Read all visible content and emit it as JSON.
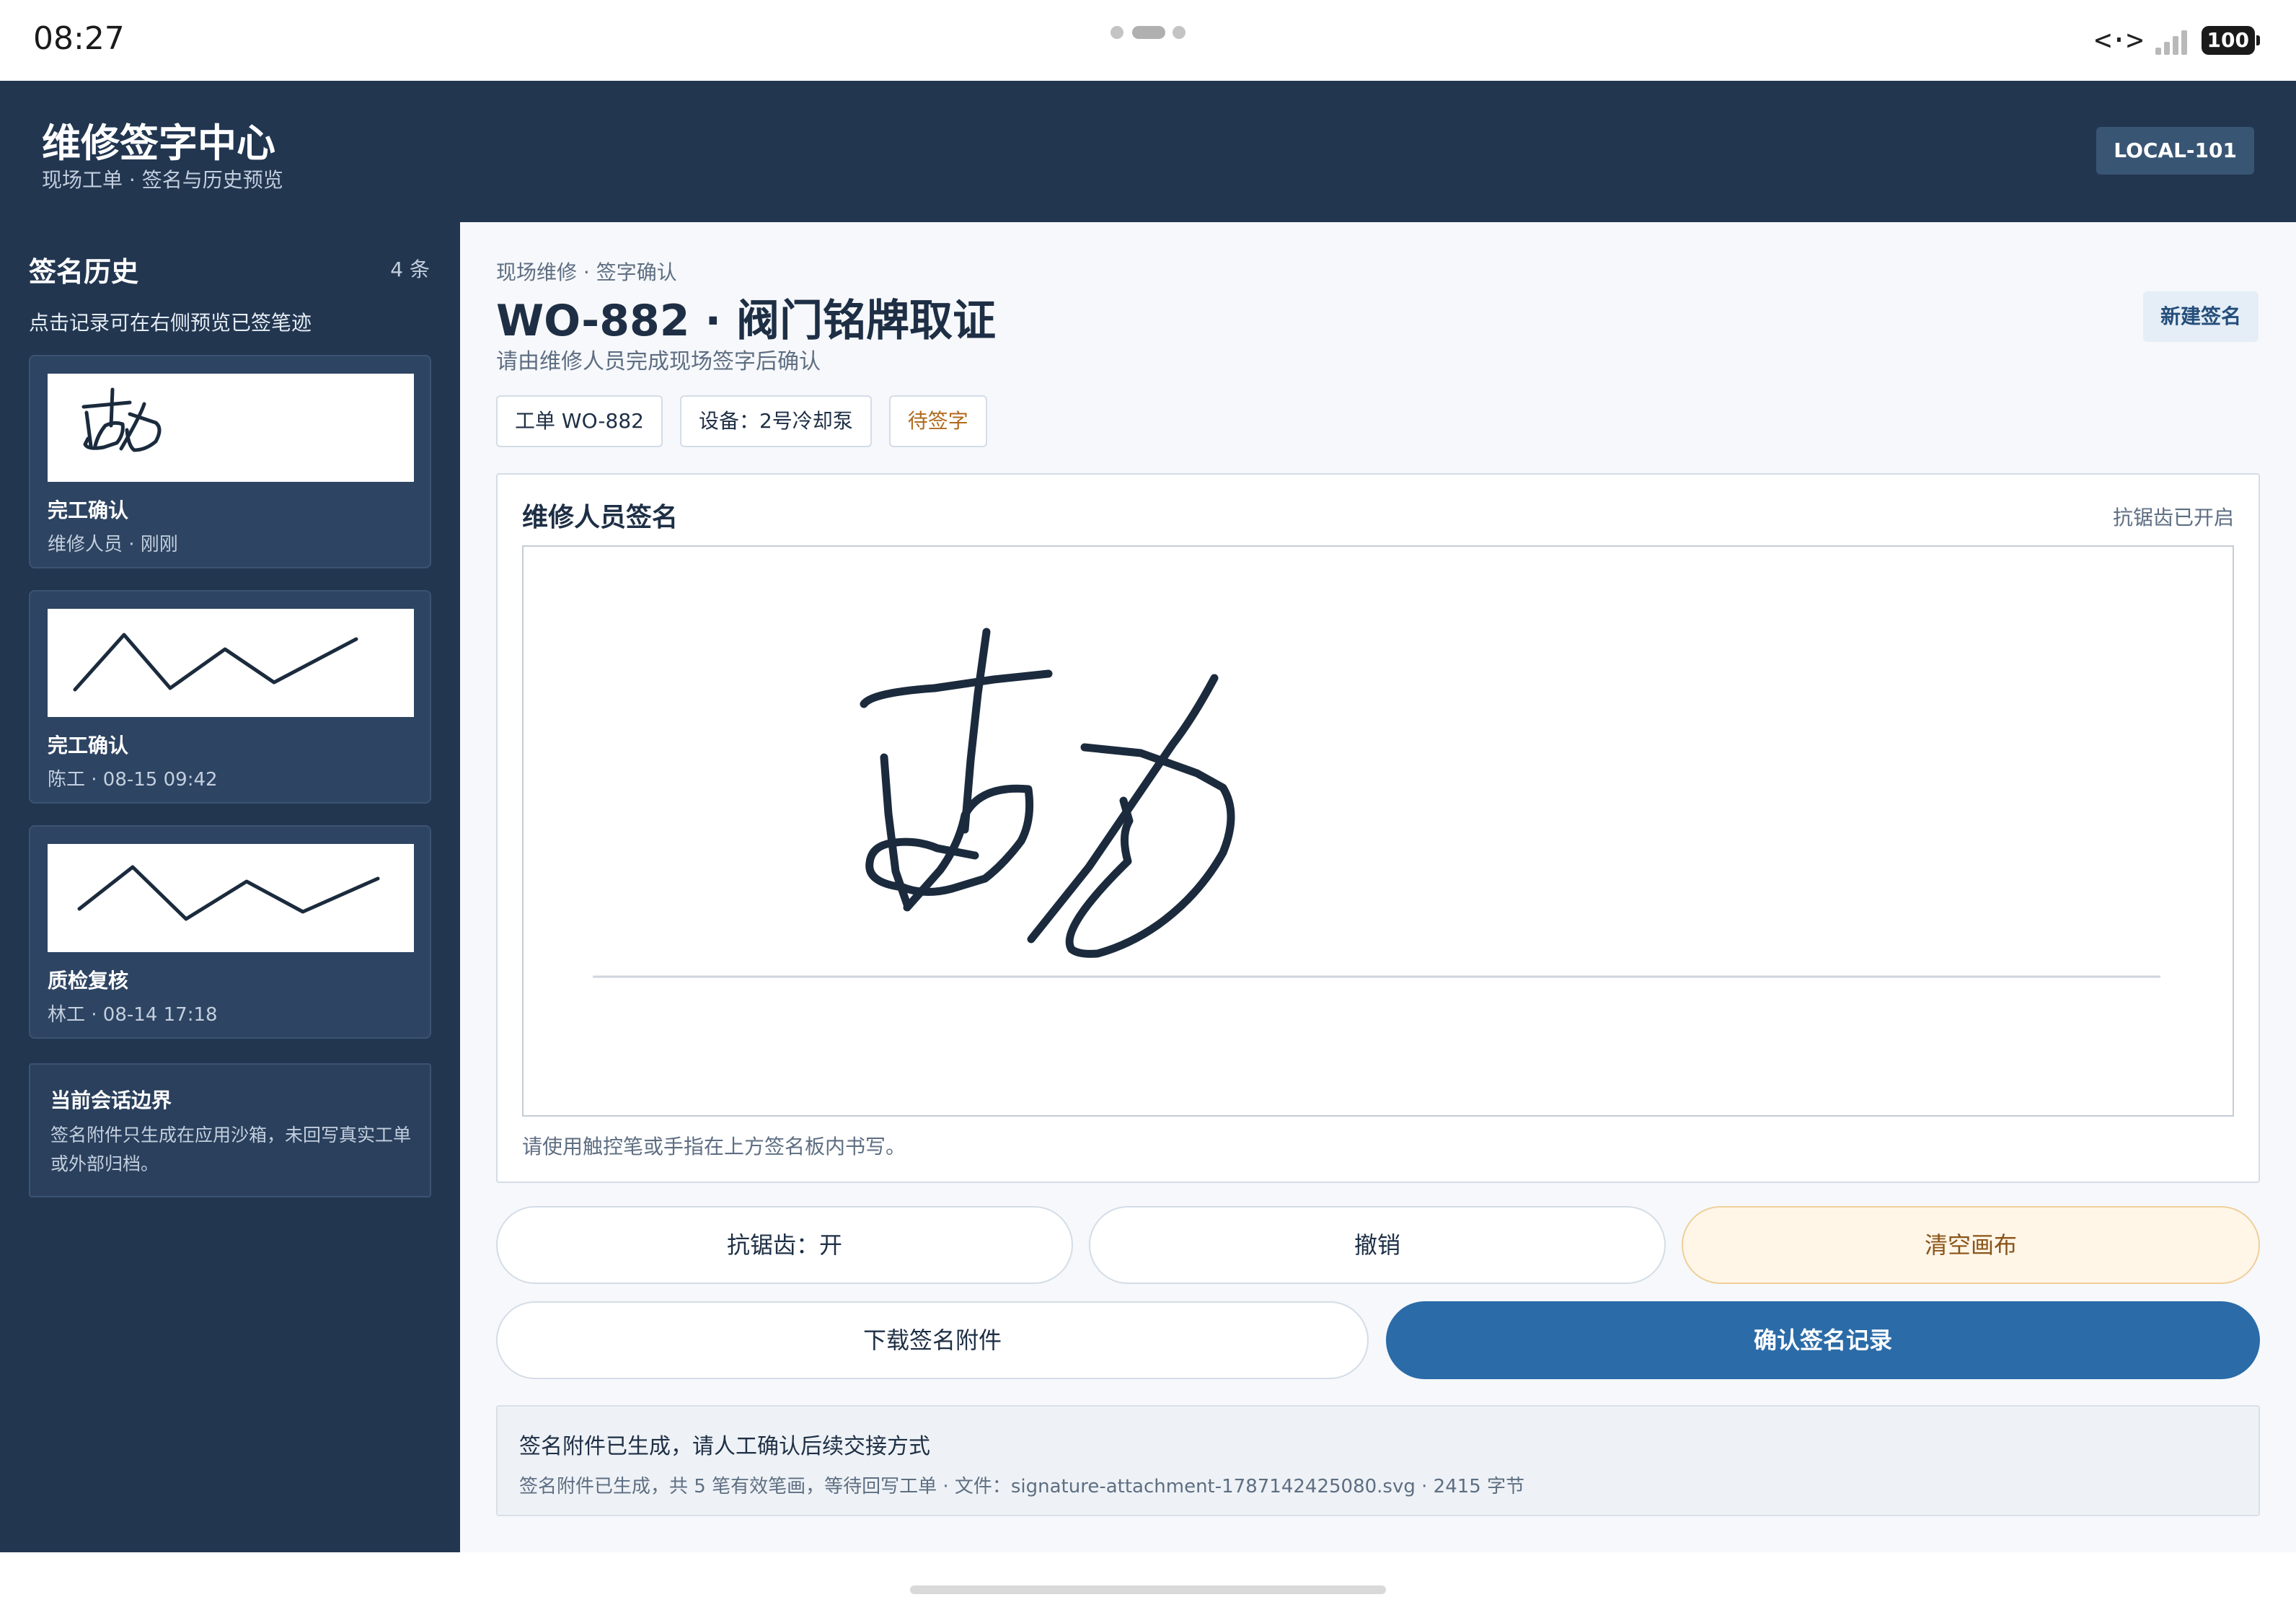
{
  "status_bar": {
    "time": "08:27",
    "network_icon": "network-arrows-icon",
    "battery": "100"
  },
  "header": {
    "title": "维修签字中心",
    "subtitle": "现场工单 · 签名与历史预览",
    "device_id": "LOCAL-101"
  },
  "sidebar": {
    "title": "签名历史",
    "count": "4 条",
    "hint": "点击记录可在右侧预览已签笔迹",
    "history": [
      {
        "title": "完工确认",
        "meta": "维修人员 · 刚刚"
      },
      {
        "title": "完工确认",
        "meta": "陈工 · 08-15 09:42"
      },
      {
        "title": "质检复核",
        "meta": "林工 · 08-14 17:18"
      }
    ],
    "boundary": {
      "title": "当前会话边界",
      "text": "签名附件只生成在应用沙箱，未回写真实工单或外部归档。"
    }
  },
  "main": {
    "breadcrumb": "现场维修 · 签字确认",
    "title": "WO-882 · 阀门铭牌取证",
    "subtitle": "请由维修人员完成现场签字后确认",
    "new_signature": "新建签名",
    "chips": {
      "order": "工单 WO-882",
      "device": "设备：2号冷却泵",
      "status": "待签字"
    },
    "panel": {
      "title": "维修人员签名",
      "antialias_state": "抗锯齿已开启",
      "hint": "请使用触控笔或手指在上方签名板内书写。"
    },
    "buttons": {
      "antialias": "抗锯齿：开",
      "undo": "撤销",
      "clear": "清空画布",
      "download": "下载签名附件",
      "confirm": "确认签名记录"
    },
    "result": {
      "title": "签名附件已生成，请人工确认后续交接方式",
      "detail": "签名附件已生成，共 5 笔有效笔画，等待回写工单 · 文件：signature-attachment-1787142425080.svg · 2415 字节"
    }
  },
  "colors": {
    "header_bg": "#223650",
    "accent": "#2a6ba8",
    "ink": "#1b2b3d",
    "pending": "#b06a1c"
  }
}
